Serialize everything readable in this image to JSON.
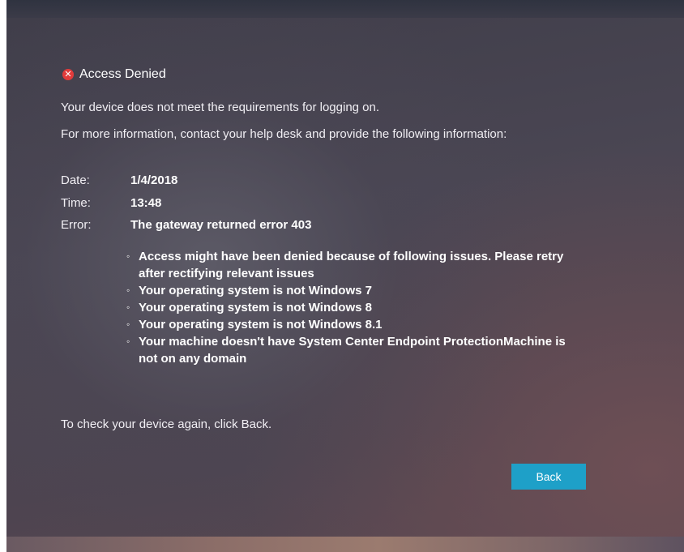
{
  "dialog": {
    "title": "Access Denied",
    "title_icon": "error-x-icon",
    "message_line1": "Your device does not meet the requirements for logging on.",
    "message_line2": "For more information, contact your help desk and provide the following information:"
  },
  "details": {
    "date_label": "Date:",
    "date_value": "1/4/2018",
    "time_label": "Time:",
    "time_value": "13:48",
    "error_label": "Error:",
    "error_value": "The gateway returned error 403"
  },
  "issues": [
    "Access might have been denied because of following issues. Please retry after rectifying relevant issues",
    "Your operating system is not Windows 7",
    "Your operating system is not Windows 8",
    "Your operating system is not Windows 8.1",
    "Your machine doesn't have System Center Endpoint ProtectionMachine is not on any domain"
  ],
  "footer": {
    "message": "To check your device again, click Back.",
    "back_label": "Back"
  },
  "colors": {
    "accent": "#1ea0c8",
    "error": "#e23b3b"
  }
}
